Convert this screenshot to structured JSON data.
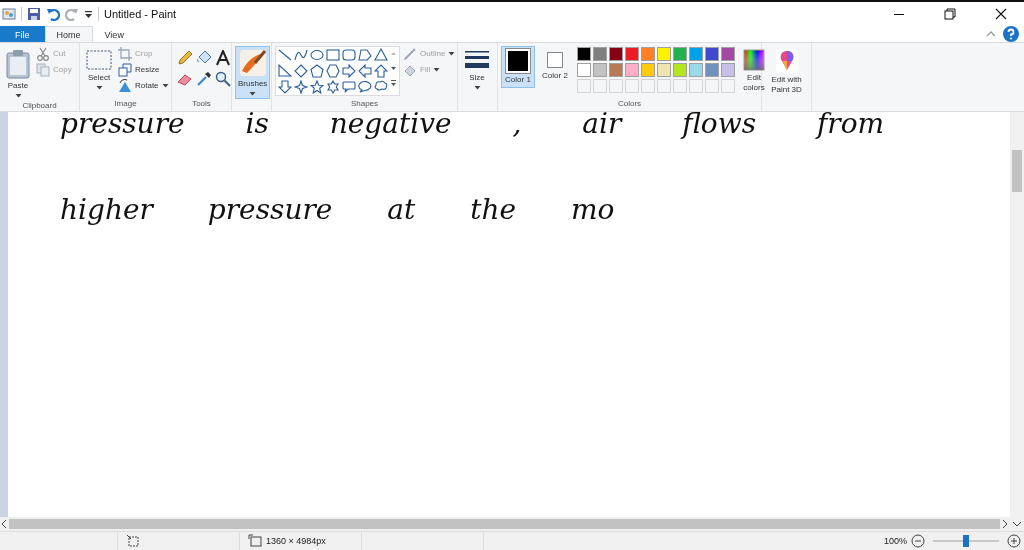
{
  "window": {
    "title": "Untitled - Paint"
  },
  "tabs": [
    {
      "label": "File",
      "kind": "file",
      "selected": false
    },
    {
      "label": "Home",
      "kind": "tab",
      "selected": true
    },
    {
      "label": "View",
      "kind": "tab",
      "selected": false
    }
  ],
  "clipboard": {
    "label": "Clipboard",
    "paste": "Paste",
    "cut": {
      "label": "Cut",
      "disabled": true
    },
    "copy": {
      "label": "Copy",
      "disabled": true
    }
  },
  "image": {
    "label": "Image",
    "select": "Select",
    "crop": {
      "label": "Crop",
      "disabled": true
    },
    "resize": {
      "label": "Resize",
      "disabled": false
    },
    "rotate": {
      "label": "Rotate",
      "disabled": false
    }
  },
  "tools": {
    "label": "Tools"
  },
  "brushes": {
    "label": "Brushes",
    "selected": true
  },
  "shapes": {
    "label": "Shapes",
    "outline": {
      "label": "Outline",
      "disabled": true
    },
    "fill": {
      "label": "Fill",
      "disabled": true
    }
  },
  "size": {
    "label": "Size"
  },
  "color_slots": [
    {
      "label": "Color 1",
      "selected": true,
      "color": "#000000"
    },
    {
      "label": "Color 2",
      "selected": false,
      "color": "#ffffff"
    }
  ],
  "colors": {
    "label": "Colors",
    "swatches": [
      {
        "kind": "color",
        "color": "#000000"
      },
      {
        "kind": "color",
        "color": "#7f7f7f"
      },
      {
        "kind": "color",
        "color": "#880015"
      },
      {
        "kind": "color",
        "color": "#ed1c24"
      },
      {
        "kind": "color",
        "color": "#ff7f27"
      },
      {
        "kind": "color",
        "color": "#fff200"
      },
      {
        "kind": "color",
        "color": "#22b14c"
      },
      {
        "kind": "color",
        "color": "#00a2e8"
      },
      {
        "kind": "color",
        "color": "#3f48cc"
      },
      {
        "kind": "color",
        "color": "#a349a4"
      },
      {
        "kind": "color",
        "color": "#ffffff"
      },
      {
        "kind": "color",
        "color": "#c3c3c3"
      },
      {
        "kind": "color",
        "color": "#b97a57"
      },
      {
        "kind": "color",
        "color": "#ffaec9"
      },
      {
        "kind": "color",
        "color": "#ffc90e"
      },
      {
        "kind": "color",
        "color": "#efe4b0"
      },
      {
        "kind": "color",
        "color": "#b5e61d"
      },
      {
        "kind": "color",
        "color": "#99d9ea"
      },
      {
        "kind": "color",
        "color": "#7092be"
      },
      {
        "kind": "color",
        "color": "#c8bfe7"
      },
      {
        "kind": "empty"
      },
      {
        "kind": "empty"
      },
      {
        "kind": "empty"
      },
      {
        "kind": "empty"
      },
      {
        "kind": "empty"
      },
      {
        "kind": "empty"
      },
      {
        "kind": "empty"
      },
      {
        "kind": "empty"
      },
      {
        "kind": "empty"
      },
      {
        "kind": "empty"
      }
    ],
    "edit_colors": "Edit colors"
  },
  "paint3d": {
    "label": "Edit with Paint 3D"
  },
  "canvas": {
    "lines": [
      "pressure is negative , air flows from",
      "higher pressure at the mo"
    ]
  },
  "status_bar": {
    "dimensions": "1360 × 4984px",
    "zoom": "100%",
    "zoom_slider": {
      "level": 0.5
    }
  }
}
